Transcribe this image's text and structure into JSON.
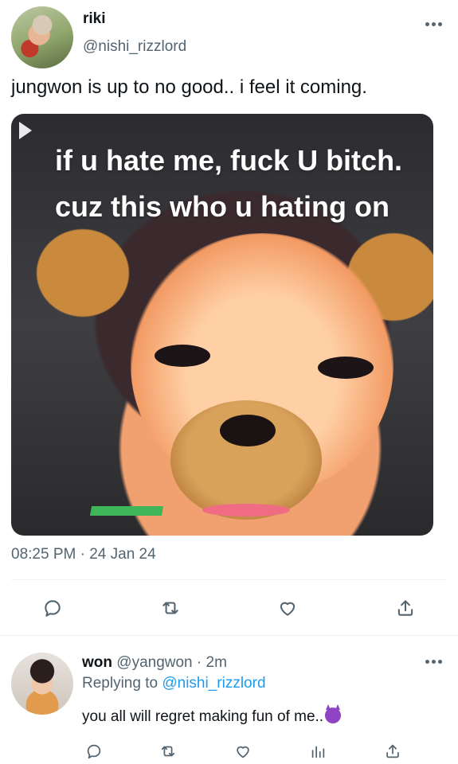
{
  "tweet": {
    "author_name": "riki",
    "author_handle": "@nishi_rizzlord",
    "text": "jungwon is up to no good.. i feel it coming.",
    "media_caption": "if u hate me, fuck U bitch. cuz this who u hating on",
    "timestamp": "08:25 PM · 24 Jan 24",
    "avatar_icon": "avatar-photo",
    "more_icon": "more-dots-icon"
  },
  "tweet_actions": [
    {
      "name": "reply",
      "icon": "reply-icon"
    },
    {
      "name": "retweet",
      "icon": "retweet-icon"
    },
    {
      "name": "like",
      "icon": "heart-icon"
    },
    {
      "name": "share",
      "icon": "share-icon"
    }
  ],
  "reply": {
    "author_name": "won",
    "author_handle": "@yangwon",
    "separator": "·",
    "time": "2m",
    "replying_prefix": "Replying to",
    "replying_handle": "@nishi_rizzlord",
    "text": "you all will regret making fun of me..",
    "emoji": "smiling-devil-emoji"
  },
  "reply_actions": [
    {
      "name": "reply",
      "icon": "reply-icon"
    },
    {
      "name": "retweet",
      "icon": "retweet-icon"
    },
    {
      "name": "like",
      "icon": "heart-icon"
    },
    {
      "name": "views",
      "icon": "analytics-icon"
    },
    {
      "name": "share",
      "icon": "share-icon"
    }
  ],
  "colors": {
    "text_primary": "#0f1419",
    "text_secondary": "#536471",
    "link": "#1d9bf0",
    "divider": "#eff3f4"
  }
}
